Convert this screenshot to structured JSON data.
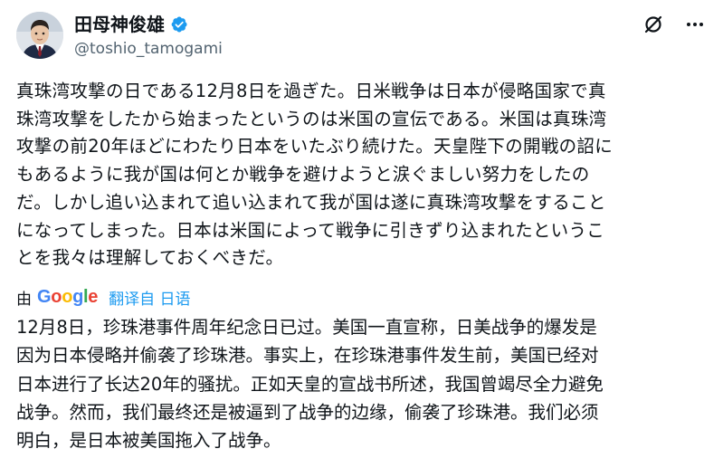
{
  "author": {
    "display_name": "田母神俊雄",
    "handle": "@toshio_tamogami",
    "verified": true,
    "avatar_icon": "person-portrait-avatar",
    "verified_icon": "verified-badge-icon",
    "verified_color": "#1d9bf0"
  },
  "header_actions": {
    "grok_icon": "grok-slash-circle-icon",
    "more_icon": "more-dots-icon"
  },
  "post": {
    "lines": [
      "真珠湾攻撃の日である12月8日を過ぎた。日米戦争は日本が侵略国家で真",
      "珠湾攻撃をしたから始まったというのは米国の宣伝である。米国は真珠湾",
      "攻撃の前20年ほどにわたり日本をいたぶり続けた。天皇陛下の開戦の詔に",
      "もあるように我が国は何とか戦争を避けようと涙ぐましい努力をしたの",
      "だ。しかし追い込まれて追い込まれて我が国は遂に真珠湾攻撃をすること",
      "になってしまった。日本は米国によって戦争に引きずり込まれたというこ",
      "とを我々は理解しておくべきだ。"
    ]
  },
  "translation": {
    "prefix": "由",
    "logo_letters": [
      "G",
      "o",
      "o",
      "g",
      "l",
      "e"
    ],
    "link_label": "翻译自 日语",
    "colors": {
      "blue": "#4285f4",
      "red": "#ea4335",
      "yellow": "#fbbc05",
      "green": "#34a853",
      "link": "#1d9bf0"
    },
    "lines": [
      "12月8日，珍珠港事件周年纪念日已过。美国一直宣称，日美战争的爆发是",
      "因为日本侵略并偷袭了珍珠港。事实上，在珍珠港事件发生前，美国已经对",
      "日本进行了长达20年的骚扰。正如天皇的宣战书所述，我国曾竭尽全力避免",
      "战争。然而，我们最终还是被逼到了战争的边缘，偷袭了珍珠港。我们必须",
      "明白，是日本被美国拖入了战争。"
    ]
  }
}
